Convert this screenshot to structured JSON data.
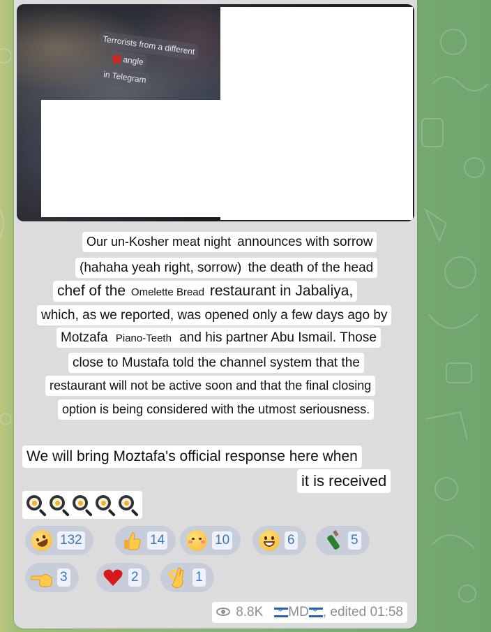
{
  "media": {
    "overlay_lines": [
      "Terrorists from a different",
      "angle",
      "in Telegram"
    ]
  },
  "message": {
    "lines": [
      {
        "parts": [
          "Our un-Kosher meat night",
          "announces with sorrow"
        ]
      },
      {
        "parts": [
          "(hahaha yeah right, sorrow)",
          "the death of the head"
        ]
      },
      {
        "parts": [
          "chef of the",
          "Omelette Bread",
          "restaurant in Jabaliya,"
        ]
      },
      {
        "parts": [
          "which, as we reported, was opened only a few days ago by"
        ]
      },
      {
        "parts": [
          "Motzafa",
          "Piano-Teeth",
          "and his partner Abu Ismail. Those"
        ]
      },
      {
        "parts": [
          "close to Mustafa told the channel system that the"
        ]
      },
      {
        "parts": [
          "restaurant will not be active soon and that the final closing"
        ]
      },
      {
        "parts": [
          "option is being considered with the utmost seriousness."
        ]
      },
      {
        "parts": [
          "We will bring Moztafa's official response here when"
        ]
      },
      {
        "parts": [
          "it is received"
        ]
      }
    ],
    "emoji_line_icons": [
      "frying-pan-egg-icon",
      "frying-pan-egg-icon",
      "frying-pan-egg-icon",
      "frying-pan-egg-icon",
      "frying-pan-egg-icon"
    ]
  },
  "reactions": [
    {
      "icon": "rofl-face-icon",
      "glyph": "🤣",
      "count": "132"
    },
    {
      "icon": "thumbs-up-icon",
      "glyph": "👍",
      "count": "14"
    },
    {
      "icon": "smiling-face-hearts-icon",
      "glyph": "🥰",
      "count": "10"
    },
    {
      "icon": "grinning-face-icon",
      "glyph": "😁",
      "count": "6"
    },
    {
      "icon": "champagne-bottle-icon",
      "glyph": "🍾",
      "count": "5"
    },
    {
      "icon": "pointing-hand-icon",
      "glyph": "👈",
      "count": "3"
    },
    {
      "icon": "red-heart-icon",
      "glyph": "❤",
      "count": "2"
    },
    {
      "icon": "ok-hand-icon",
      "glyph": "👌",
      "count": "1"
    }
  ],
  "footer": {
    "views": "8.8K",
    "author": "MD",
    "edited": ", edited 01:58"
  },
  "colors": {
    "reaction_count": "#3a76b8",
    "bubble": "#dcdcdc",
    "meta": "#8b8f94"
  }
}
